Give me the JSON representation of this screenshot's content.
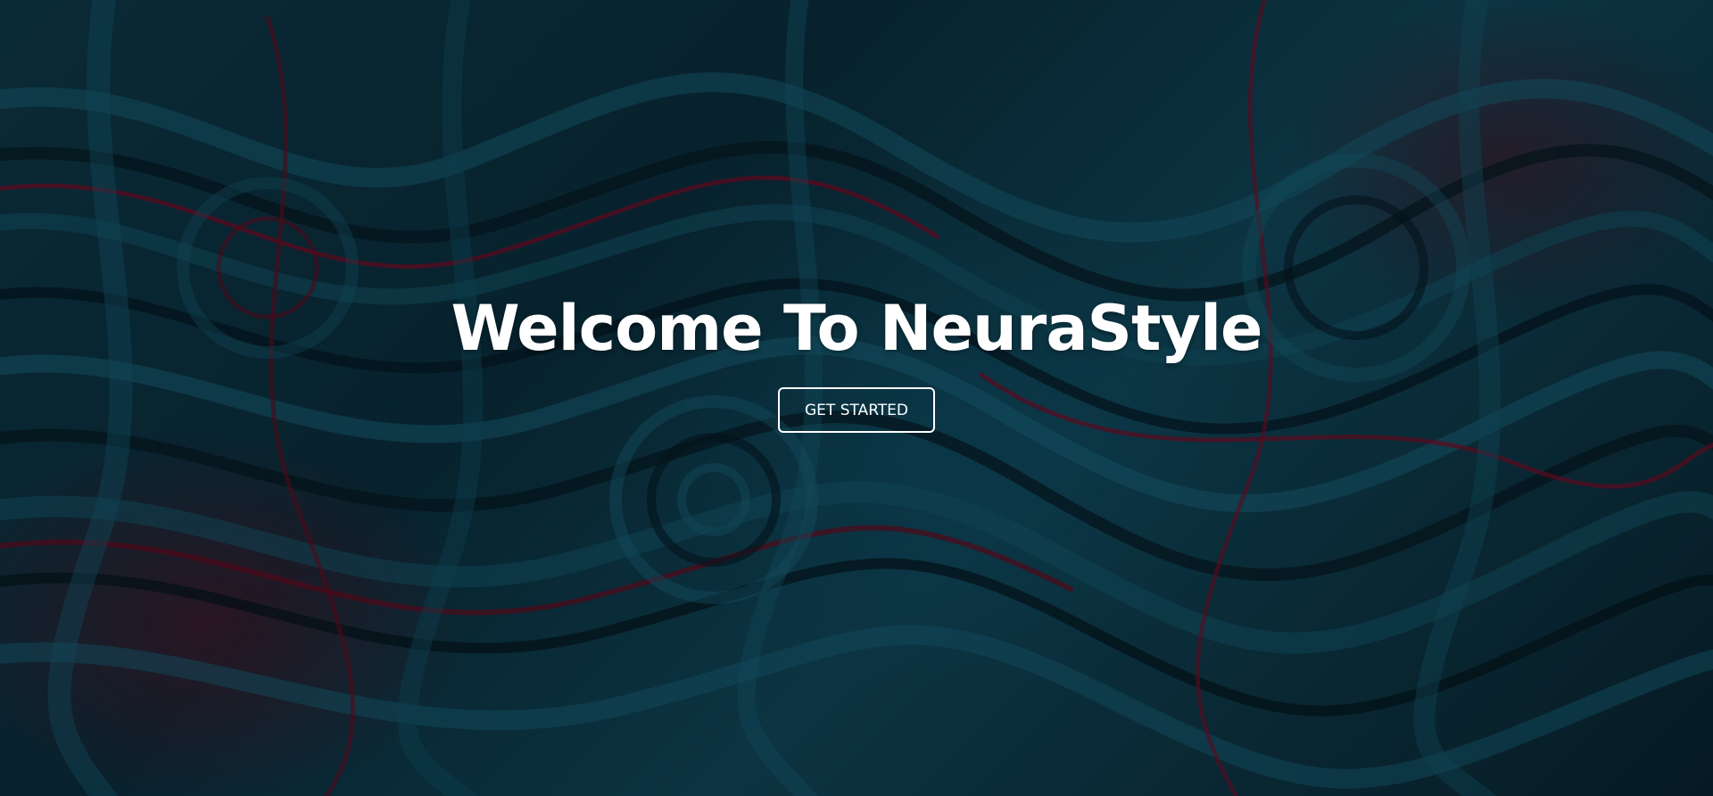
{
  "hero": {
    "title": "Welcome To NeuraStyle",
    "cta_label": "GET STARTED"
  },
  "colors": {
    "text": "#ffffff",
    "background_teal": "#0c3442",
    "background_dark": "#061a23",
    "accent_crimson": "#5a0a1e"
  }
}
